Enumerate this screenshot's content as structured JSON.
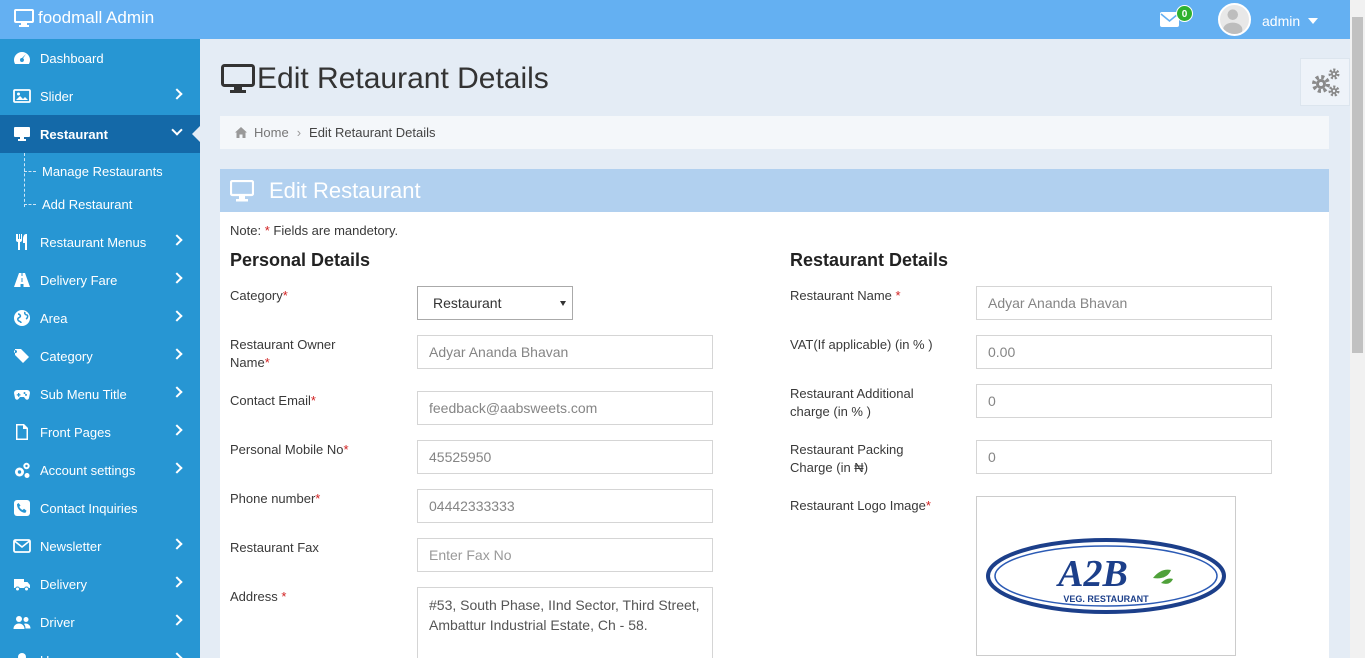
{
  "navbar": {
    "brand": "foodmall Admin",
    "mail_count": "0",
    "user": "admin"
  },
  "sidebar": {
    "items": [
      {
        "label": "Dashboard",
        "icon": "tachometer-icon",
        "chevron": false
      },
      {
        "label": "Slider",
        "icon": "image-icon",
        "chevron": true
      },
      {
        "label": "Restaurant",
        "icon": "desktop-icon",
        "chevron": true,
        "active": true
      },
      {
        "label": "Restaurant Menus",
        "icon": "cutlery-icon",
        "chevron": true
      },
      {
        "label": "Delivery Fare",
        "icon": "road-icon",
        "chevron": true
      },
      {
        "label": "Area",
        "icon": "globe-icon",
        "chevron": true
      },
      {
        "label": "Category",
        "icon": "tags-icon",
        "chevron": true
      },
      {
        "label": "Sub Menu Title",
        "icon": "gamepad-icon",
        "chevron": true
      },
      {
        "label": "Front Pages",
        "icon": "file-icon",
        "chevron": true
      },
      {
        "label": "Account settings",
        "icon": "cogs-icon",
        "chevron": true
      },
      {
        "label": "Contact Inquiries",
        "icon": "phone-icon",
        "chevron": false
      },
      {
        "label": "Newsletter",
        "icon": "envelope-icon",
        "chevron": true
      },
      {
        "label": "Delivery",
        "icon": "truck-icon",
        "chevron": true
      },
      {
        "label": "Driver",
        "icon": "users-icon",
        "chevron": true
      },
      {
        "label": "Users",
        "icon": "user-icon",
        "chevron": true
      }
    ],
    "submenu": [
      "Manage Restaurants",
      "Add Restaurant"
    ]
  },
  "page": {
    "title": "Edit Retaurant Details",
    "breadcrumb": {
      "home": "Home",
      "current": "Edit Retaurant Details"
    }
  },
  "card": {
    "title": "Edit Restaurant",
    "note_prefix": "Note:",
    "note_star": "*",
    "note_text": "Fields are mandetory.",
    "personal": {
      "title": "Personal Details",
      "category_label": "Category",
      "category_value": "Restaurant",
      "owner_label_1": "Restaurant Owner",
      "owner_label_2": "Name",
      "owner_value": "Adyar Ananda Bhavan",
      "email_label": "Contact Email",
      "email_value": "feedback@aabsweets.com",
      "mobile_label": "Personal Mobile No",
      "mobile_value": "45525950",
      "phone_label": "Phone number",
      "phone_value": "04442333333",
      "fax_label": "Restaurant Fax",
      "fax_placeholder": "Enter Fax No",
      "address_label": "Address ",
      "address_value": "#53, South Phase, IInd Sector, Third Street, Ambattur Industrial Estate, Ch - 58."
    },
    "restaurant": {
      "title": "Restaurant Details",
      "name_label": "Restaurant Name ",
      "name_value": "Adyar Ananda Bhavan",
      "vat_label": "VAT(If applicable) (in % )",
      "vat_value": "0.00",
      "additional_label_1": "Restaurant Additional",
      "additional_label_2": "charge (in % )",
      "additional_value": "0",
      "packing_label_1": "Restaurant Packing",
      "packing_label_2": "Charge (in ₦)",
      "packing_value": "0",
      "logo_label": "Restaurant Logo Image",
      "logo_text": "A2B",
      "logo_subtext": "VEG. RESTAURANT"
    }
  },
  "colors": {
    "navbar": "#64b0f2",
    "sidebar": "#2796d3",
    "sidebar_active": "#1469a8",
    "card_head": "#b1d0ef",
    "required": "#d12020"
  }
}
